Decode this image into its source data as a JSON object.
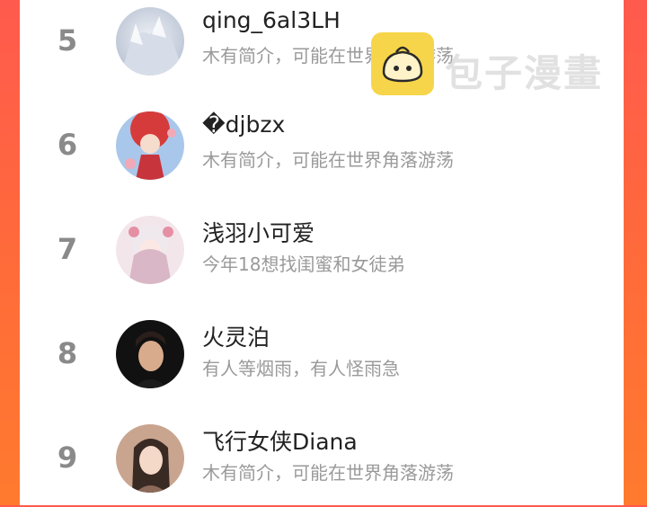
{
  "ranking": [
    {
      "rank": "5",
      "name": "qing_6al3LH",
      "bio": "木有简介，可能在世界角落游荡"
    },
    {
      "rank": "6",
      "name": "�djbzx",
      "bio": "木有简介，可能在世界角落游荡"
    },
    {
      "rank": "7",
      "name": "浅羽小可爱",
      "bio": "今年18想找闺蜜和女徒弟"
    },
    {
      "rank": "8",
      "name": "火灵泊",
      "bio": "有人等烟雨，有人怪雨急"
    },
    {
      "rank": "9",
      "name": "飞行女侠Diana",
      "bio": "木有简介，可能在世界角落游荡"
    }
  ],
  "watermark": {
    "text": "包子漫畫",
    "icon": "bun-mascot-icon"
  },
  "colors": {
    "background_top": "#ff5a4e",
    "background_bottom": "#ff7a2e",
    "rank": "#8a8a8a",
    "name": "#222222",
    "bio": "#9a9a9a"
  }
}
